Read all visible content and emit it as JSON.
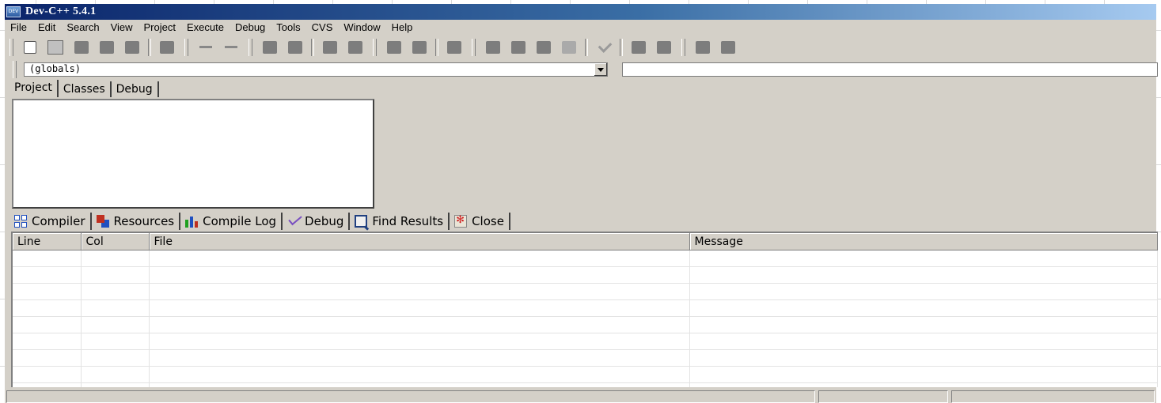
{
  "window": {
    "title": "Dev-C++ 5.4.1",
    "icon": "dev-app-icon"
  },
  "menubar": {
    "items": [
      "File",
      "Edit",
      "Search",
      "View",
      "Project",
      "Execute",
      "Debug",
      "Tools",
      "CVS",
      "Window",
      "Help"
    ]
  },
  "toolbar": {
    "icons": [
      "new-file-icon",
      "open-file-icon",
      "save-icon",
      "save-all-icon",
      "close-icon",
      "print-icon",
      "undo-icon",
      "redo-icon",
      "find-icon",
      "replace-icon",
      "goto-icon",
      "goto-line-icon",
      "compile-icon",
      "run-icon",
      "compile-run-icon",
      "debug-icon",
      "new-project-icon",
      "add-file-icon",
      "remove-file-icon",
      "project-options-icon",
      "check-syntax-icon",
      "insert-icon",
      "toggle-icon",
      "goto-bookmark-icon",
      "exit-icon"
    ]
  },
  "class_browser": {
    "scope_value": "(globals)",
    "function_value": ""
  },
  "left_tabs": {
    "project": "Project",
    "classes": "Classes",
    "debug": "Debug"
  },
  "bottom_tabs": {
    "compiler": "Compiler",
    "resources": "Resources",
    "compile_log": "Compile Log",
    "debug": "Debug",
    "find_results": "Find Results",
    "close": "Close"
  },
  "results": {
    "columns": [
      "Line",
      "Col",
      "File",
      "Message"
    ]
  }
}
